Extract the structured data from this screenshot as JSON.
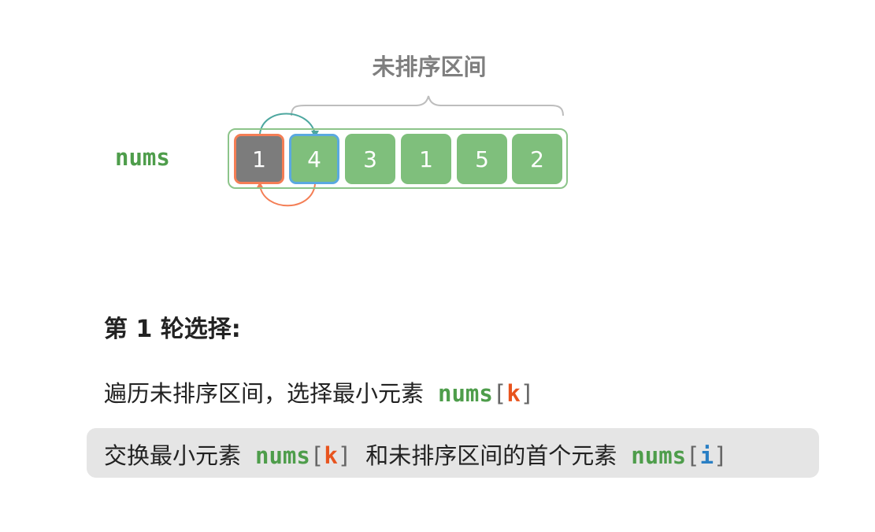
{
  "header": {
    "range_title": "未排序区间"
  },
  "array": {
    "label": "nums",
    "cells": [
      "1",
      "4",
      "3",
      "1",
      "5",
      "2"
    ]
  },
  "text": {
    "round_title": "第 1 轮选择:",
    "step1_prefix": "遍历未排序区间，选择最小元素",
    "step2_prefix": "交换最小元素",
    "step2_middle": "和未排序区间的首个元素",
    "code_nums": "nums",
    "lbracket": "[",
    "rbracket": "]",
    "code_k": "k",
    "code_i": "i"
  },
  "colors": {
    "sorted_cell": "#7c7c7c",
    "unsorted_cell": "#7fbf7c",
    "min_border": "#f47e55",
    "target_border": "#5aa9e0",
    "code_green": "#4e9d4b",
    "k_orange": "#e8541e",
    "i_blue": "#2a7fc4"
  }
}
